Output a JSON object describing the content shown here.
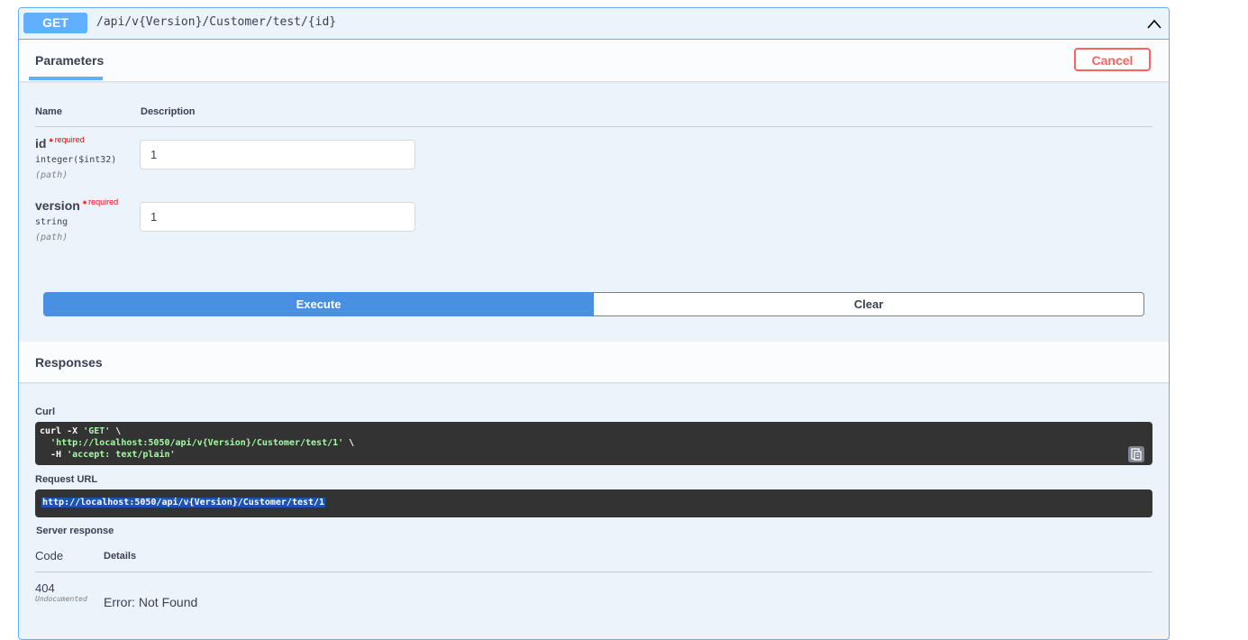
{
  "operation": {
    "method": "GET",
    "path": "/api/v{Version}/Customer/test/{id}"
  },
  "parameters": {
    "tab_label": "Parameters",
    "cancel_label": "Cancel",
    "columns": {
      "name": "Name",
      "description": "Description"
    },
    "items": [
      {
        "name": "id",
        "star": "*",
        "required": "required",
        "type": "integer($int32)",
        "in": "(path)",
        "value": "1"
      },
      {
        "name": "version",
        "star": "*",
        "required": "required",
        "type": "string",
        "in": "(path)",
        "value": "1"
      }
    ],
    "execute_label": "Execute",
    "clear_label": "Clear"
  },
  "responses": {
    "title": "Responses",
    "curl_label": "Curl",
    "curl_lines": [
      {
        "plain": "curl -X ",
        "str": "'GET'",
        "tail": " \\"
      },
      {
        "plain": "  ",
        "str": "'http://localhost:5050/api/v{Version}/Customer/test/1'",
        "tail": " \\"
      },
      {
        "plain": "  -H ",
        "str": "'accept: text/plain'",
        "tail": ""
      }
    ],
    "request_url_label": "Request URL",
    "request_url": "http://localhost:5050/api/v{Version}/Customer/test/1",
    "server_response_label": "Server response",
    "code_header": "Code",
    "details_header": "Details",
    "status_code": "404",
    "undocumented": "Undocumented",
    "error_text": "Error: Not Found"
  },
  "colors": {
    "get_accent": "#61affe",
    "execute": "#4990e2",
    "cancel": "#ff6060",
    "code_bg": "#333333",
    "code_string": "#a2fca2"
  }
}
